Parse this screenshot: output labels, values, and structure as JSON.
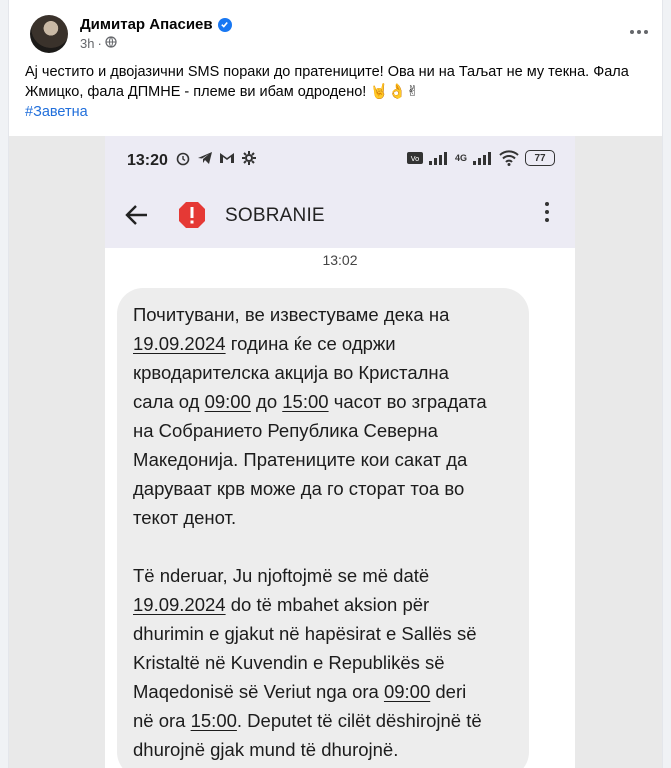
{
  "post": {
    "author": "Димитар Апасиев",
    "time": "3h",
    "text_line1": "Ај честито и двојазични SMS пораки до пратениците! Ова ни на Таљат не му текна. Фала",
    "text_line2": "Жмицко, фала ДПМНЕ - племе ви ибам одродено! 🤘👌✌",
    "hashtag": "#Заветна"
  },
  "phone": {
    "status_time": "13:20",
    "battery": "77",
    "network": "4G",
    "sender": "SOBRANIE",
    "message_time": "13:02",
    "message": {
      "mk": {
        "l1": "Почитувани, ве известуваме дека на",
        "l2_date": "19.09.2024",
        "l2_rest": " година ќе се одржи",
        "l3": "крводарителска акција во Кристална",
        "l4_a": "сала од ",
        "l4_start": "09:00",
        "l4_b": " до ",
        "l4_end": "15:00",
        "l4_c": " часот во зградата",
        "l5": "на Собранието Република Северна",
        "l6": "Македонија. Пратениците кои сакат да",
        "l7": "даруваат крв може да го сторат тоа во",
        "l8": "текот денот."
      },
      "sq": {
        "l1": "Të nderuar, Ju njoftojmë se më datë",
        "l2_date": "19.09.2024",
        "l2_rest": " do të mbahet aksion për",
        "l3": "dhurimin e gjakut në  hapësirat e Sallës së",
        "l4": "Kristaltë në Kuvendin e Republikës së",
        "l5_a": "Maqedonisë së Veriut nga ora ",
        "l5_start": "09:00",
        "l5_b": " deri",
        "l6_a": "në ora ",
        "l6_end": "15:00",
        "l6_b": ". Deputet të cilët dëshirojnë të",
        "l7": "dhurojnë gjak mund të dhurojnë."
      }
    }
  },
  "colors": {
    "link": "#216fdb",
    "verified": "#1877f2",
    "alert": "#e53935",
    "phone_bar": "#ecebf4",
    "bubble": "#ededed"
  }
}
